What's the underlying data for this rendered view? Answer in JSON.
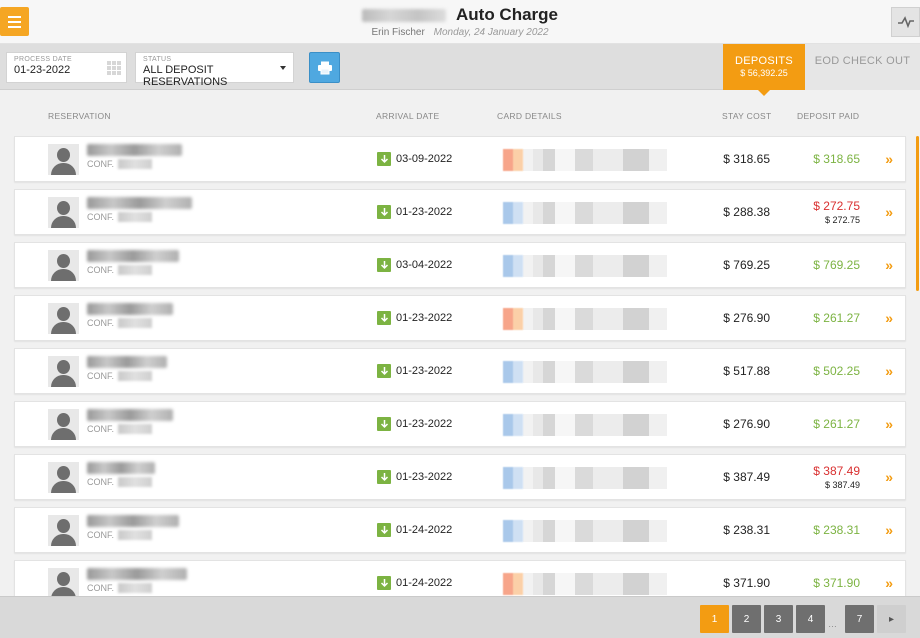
{
  "header": {
    "title": "Auto Charge",
    "user": "Erin Fischer",
    "date": "Monday, 24 January 2022"
  },
  "filters": {
    "process_date_label": "PROCESS DATE",
    "process_date_value": "01-23-2022",
    "status_label": "STATUS",
    "status_value": "ALL DEPOSIT RESERVATIONS"
  },
  "tabs": {
    "deposits_label": "DEPOSITS",
    "deposits_total": "$ 56,392.25",
    "eod_label": "EOD CHECK OUT"
  },
  "columns": {
    "reservation": "RESERVATION",
    "arrival": "ARRIVAL DATE",
    "card": "CARD DETAILS",
    "stay_cost": "STAY COST",
    "deposit_paid": "DEPOSIT PAID"
  },
  "conf_prefix": "CONF.",
  "rows": [
    {
      "arrival": "03-09-2022",
      "stay": "$ 318.65",
      "paid": "$ 318.65",
      "status": "paid",
      "card_color": "orange"
    },
    {
      "arrival": "01-23-2022",
      "stay": "$ 288.38",
      "paid": "$ 272.75",
      "paid_sub": "$ 272.75",
      "status": "partial",
      "card_color": "blue"
    },
    {
      "arrival": "03-04-2022",
      "stay": "$ 769.25",
      "paid": "$ 769.25",
      "status": "paid",
      "card_color": "blue"
    },
    {
      "arrival": "01-23-2022",
      "stay": "$ 276.90",
      "paid": "$ 261.27",
      "status": "paid",
      "card_color": "orange"
    },
    {
      "arrival": "01-23-2022",
      "stay": "$ 517.88",
      "paid": "$ 502.25",
      "status": "paid",
      "card_color": "blue"
    },
    {
      "arrival": "01-23-2022",
      "stay": "$ 276.90",
      "paid": "$ 261.27",
      "status": "paid",
      "card_color": "blue"
    },
    {
      "arrival": "01-23-2022",
      "stay": "$ 387.49",
      "paid": "$ 387.49",
      "paid_sub": "$ 387.49",
      "status": "partial",
      "card_color": "blue"
    },
    {
      "arrival": "01-24-2022",
      "stay": "$ 238.31",
      "paid": "$ 238.31",
      "status": "paid",
      "card_color": "blue"
    },
    {
      "arrival": "01-24-2022",
      "stay": "$ 371.90",
      "paid": "$ 371.90",
      "status": "paid",
      "card_color": "orange"
    }
  ],
  "pagination": {
    "pages": [
      "1",
      "2",
      "3",
      "4"
    ],
    "last": "7",
    "current": "1"
  },
  "colors": {
    "accent": "#f39c12",
    "green": "#7cb342",
    "red": "#d93030",
    "blue": "#4fa8e0"
  }
}
